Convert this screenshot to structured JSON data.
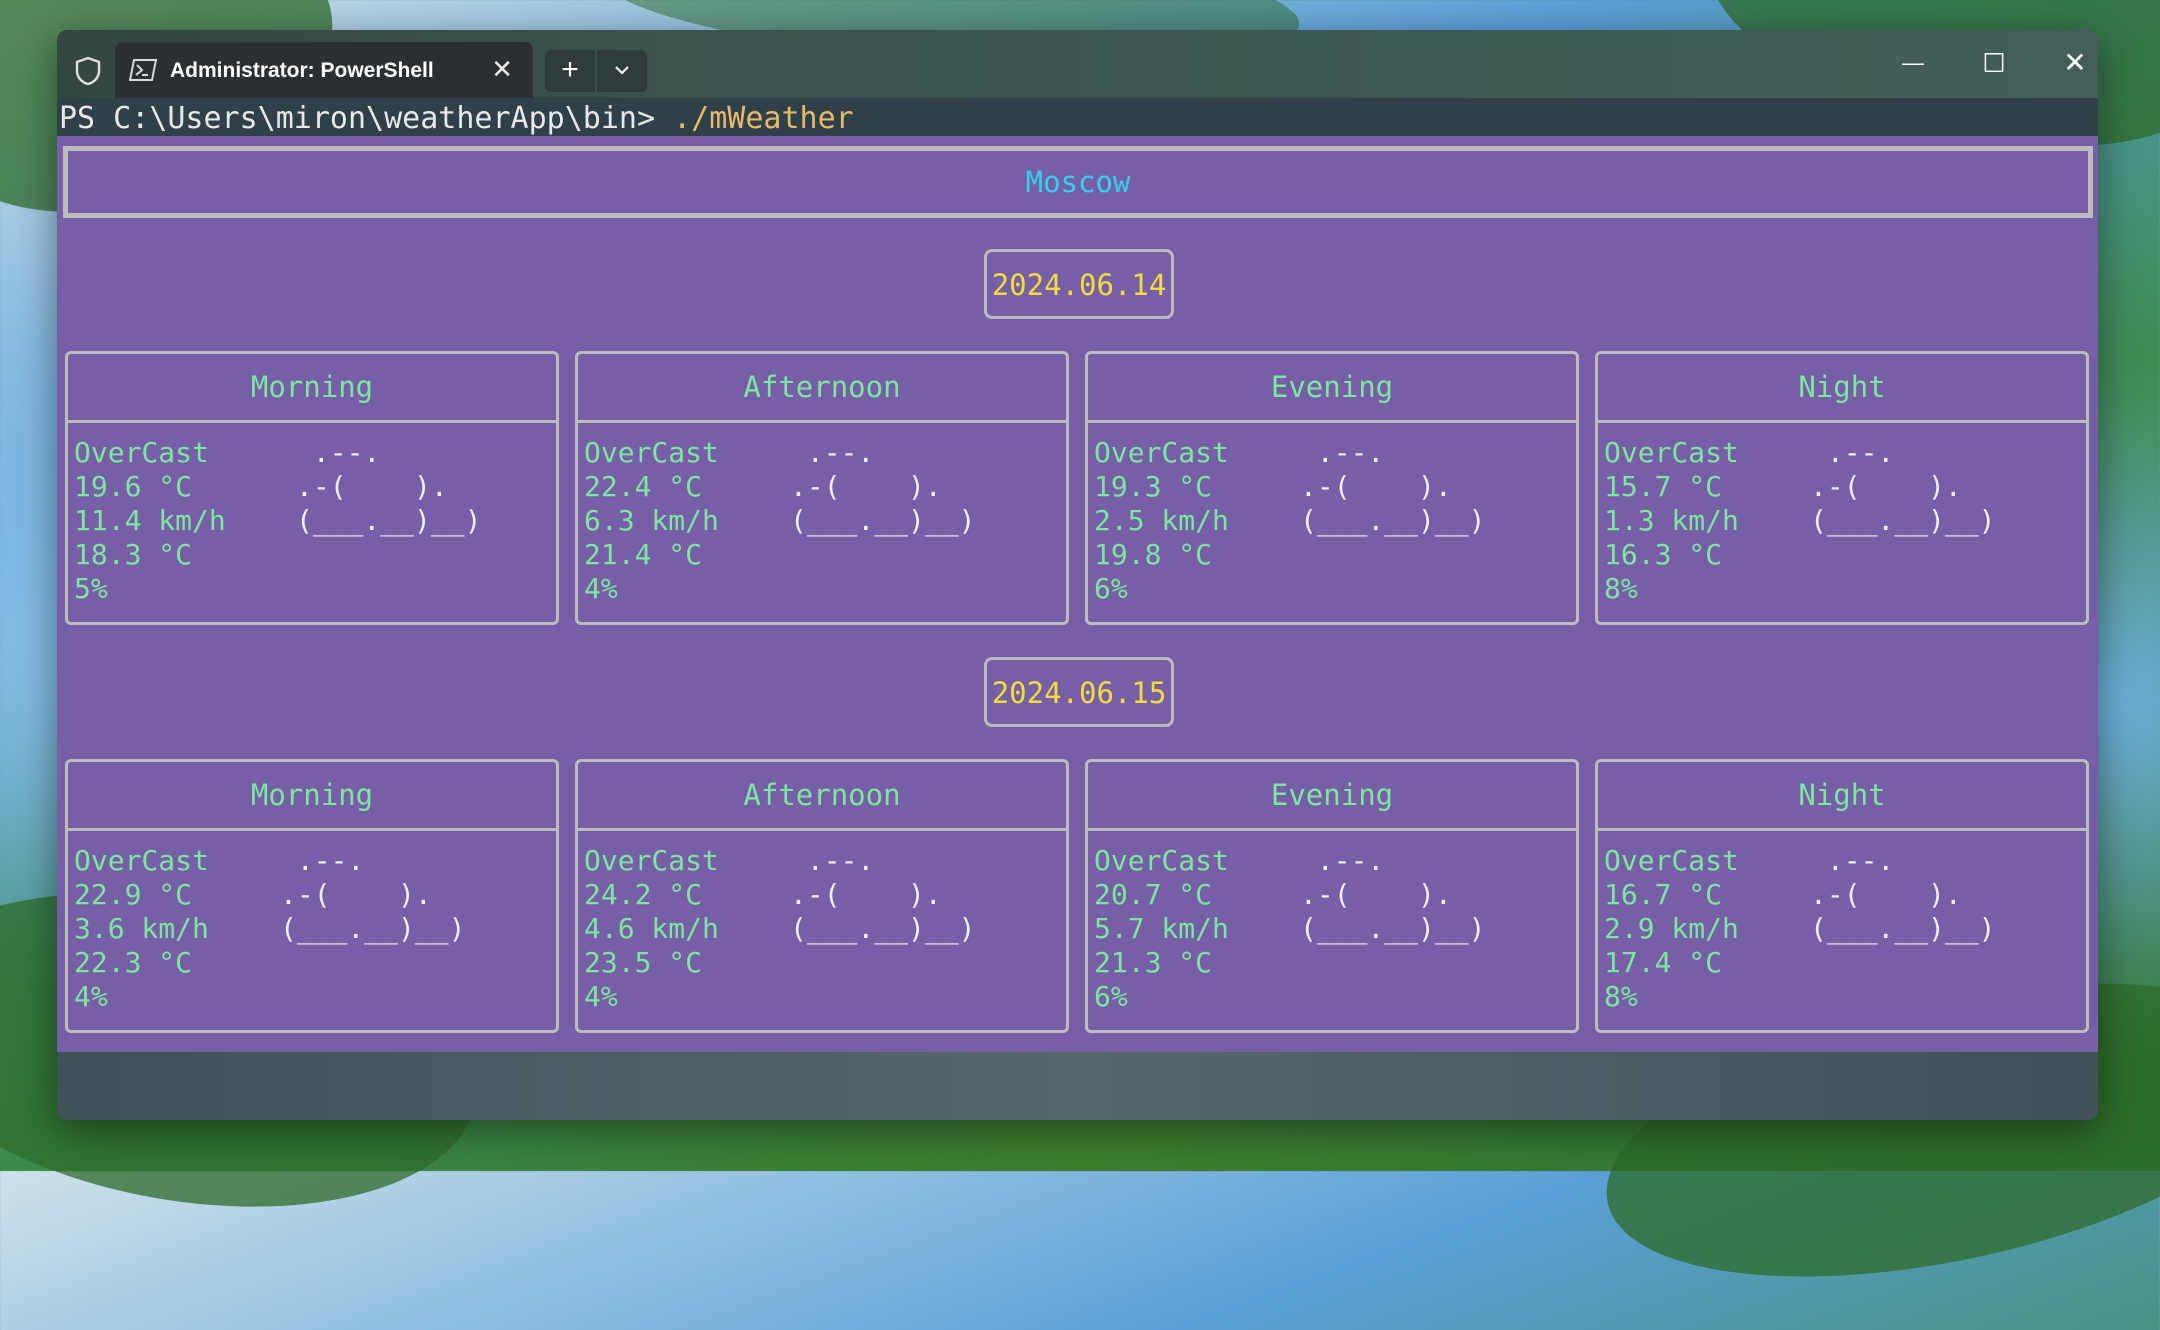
{
  "window": {
    "tab_title": "Administrator: PowerShell",
    "close_tab_symbol": "✕",
    "new_tab_symbol": "+",
    "minimize_symbol": "—",
    "maximize_symbol": "☐",
    "close_symbol": "✕"
  },
  "terminal": {
    "prompt": "PS C:\\Users\\miron\\weatherApp\\bin> ",
    "command": "./mWeather"
  },
  "weather": {
    "city": "Moscow",
    "cloud_art": " .--.\n.-(    ).\n(___.__)__)",
    "days": [
      {
        "date": "2024.06.14",
        "periods": [
          {
            "name": "Morning",
            "condition": "OverCast",
            "temp": "19.6 °C",
            "wind": "11.4 km/h",
            "feels": "18.3 °C",
            "precip": "5%"
          },
          {
            "name": "Afternoon",
            "condition": "OverCast",
            "temp": "22.4 °C",
            "wind": "6.3 km/h",
            "feels": "21.4 °C",
            "precip": "4%"
          },
          {
            "name": "Evening",
            "condition": "OverCast",
            "temp": "19.3 °C",
            "wind": "2.5 km/h",
            "feels": "19.8 °C",
            "precip": "6%"
          },
          {
            "name": "Night",
            "condition": "OverCast",
            "temp": "15.7 °C",
            "wind": "1.3 km/h",
            "feels": "16.3 °C",
            "precip": "8%"
          }
        ]
      },
      {
        "date": "2024.06.15",
        "periods": [
          {
            "name": "Morning",
            "condition": "OverCast",
            "temp": "22.9 °C",
            "wind": "3.6 km/h",
            "feels": "22.3 °C",
            "precip": "4%"
          },
          {
            "name": "Afternoon",
            "condition": "OverCast",
            "temp": "24.2 °C",
            "wind": "4.6 km/h",
            "feels": "23.5 °C",
            "precip": "4%"
          },
          {
            "name": "Evening",
            "condition": "OverCast",
            "temp": "20.7 °C",
            "wind": "5.7 km/h",
            "feels": "21.3 °C",
            "precip": "6%"
          },
          {
            "name": "Night",
            "condition": "OverCast",
            "temp": "16.7 °C",
            "wind": "2.9 km/h",
            "feels": "17.4 °C",
            "precip": "8%"
          }
        ]
      }
    ]
  },
  "colors": {
    "panel_bg": "#765fa6",
    "city_text": "#33d0ee",
    "date_text": "#f3dd3e",
    "stats_text": "#7ee6a0",
    "border": "#bcbcbc",
    "command_text": "#e6b96b"
  },
  "icons": [
    "shield-icon",
    "powershell-icon",
    "close-tab-icon",
    "new-tab-icon",
    "chevron-down-icon",
    "minimize-icon",
    "maximize-icon",
    "close-icon",
    "cloud-icon"
  ]
}
